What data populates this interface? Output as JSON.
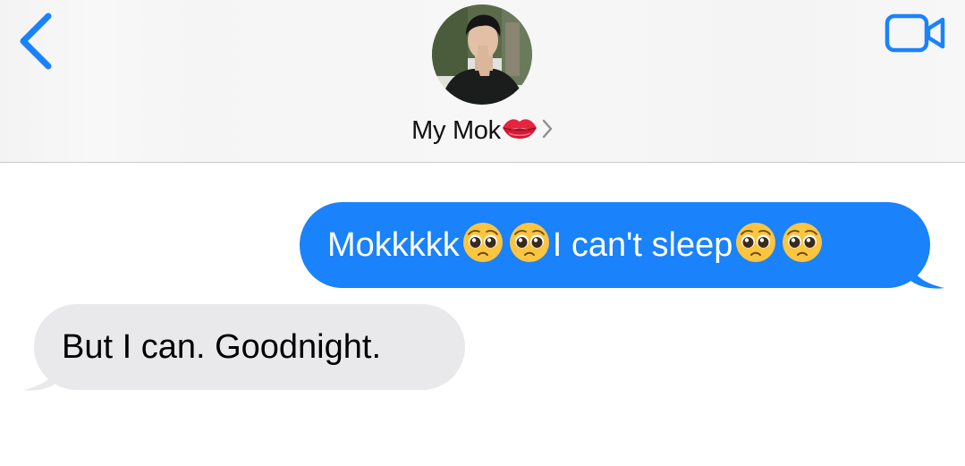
{
  "header": {
    "contact_name": "My Mok",
    "contact_emoji": "lips-emoji",
    "back_icon": "chevron-left-icon",
    "video_icon": "video-camera-icon",
    "disclosure_icon": "chevron-right-icon",
    "accent_color": "#1a82fb"
  },
  "messages": [
    {
      "direction": "outgoing",
      "segments": [
        "Mokkkkk",
        "pleading-face-emoji",
        "pleading-face-emoji",
        "I can't sleep",
        "pleading-face-emoji",
        "pleading-face-emoji"
      ],
      "text_part_1": "Mokkkkk",
      "text_part_2": "I can't sleep",
      "bubble_color": "#1a82fb"
    },
    {
      "direction": "incoming",
      "text": "But I can. Goodnight.",
      "bubble_color": "#e9e9eb"
    }
  ]
}
